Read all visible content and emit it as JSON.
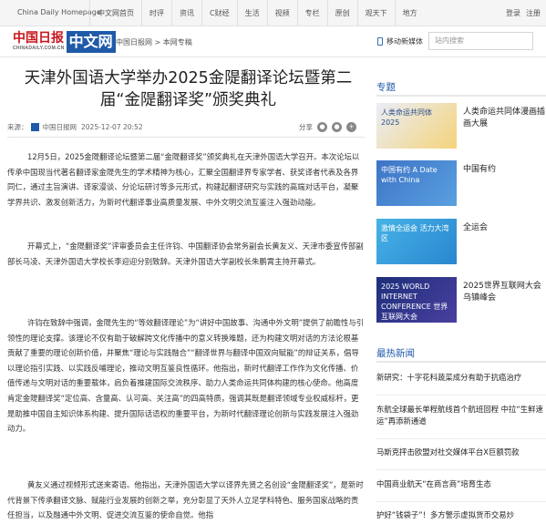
{
  "topbar": {
    "site": "China Daily Homepage",
    "nav": [
      "中文网首页",
      "时评",
      "资讯",
      "C财经",
      "生活",
      "视频",
      "专栏",
      "原创",
      "观天下",
      "地方"
    ],
    "login": "登录",
    "register": "注册"
  },
  "header": {
    "logo_cn": "中国日报",
    "logo_en": "CHINADAILY.COM.CN",
    "logo_box": "中文网",
    "breadcrumb": "中国日报网 > 本网专稿",
    "mobile": "移动新媒体",
    "search_placeholder": "站内搜索"
  },
  "article": {
    "title": "天津外国语大学举办2025金隄翻译论坛暨第二届“金隄翻译奖”颁奖典礼",
    "source_label": "来源：",
    "source": "中国日报网",
    "date": "2025-12-07 20:52",
    "share": "分享",
    "paragraphs": [
      "12月5日，2025金隄翻译论坛暨第二届“金隄翻译奖”颁奖典礼在天津外国语大学召开。本次论坛以传承中国现当代著名翻译家金隄先生的学术精神为核心，汇聚全国翻译界专家学者、获奖译者代表及各界同仁，通过主旨演讲、译家漫谈、分论坛研讨等多元形式，构建起翻译研究与实践的高端对话平台，凝聚学界共识、激发创新活力，为新时代翻译事业高质量发展、中外文明交流互鉴注入强劲动能。",
      "开幕式上，“金隄翻译奖”评审委员会主任许钧、中国翻译协会常务副会长黄友义、天津市委宣传部副部长马凌、天津外国语大学校长李迎迎分别致辞。天津外国语大学副校长朱鹏霄主持开幕式。",
      "许钧在致辞中强调，金隄先生的“等效翻译理论”为“讲好中国故事、沟通中外文明”提供了前瞻性与引领性的理论支撑。该理论不仅有助于破解跨文化传播中的意义转换难题，还为构建文明对话的方法论根基贡献了重要的理论创新价值，并聚焦“理论与实践融合”“翻译世界与翻译中国双向赋能”的辩证关系，倡导以理论指引实践、以实践反哺理论，推动文明互鉴良性循环。他指出，新时代翻译工作作为文化传播、价值传递与文明对话的重要载体，肩负着推建国际交流秩序、助力人类命运共同体构建的核心使命。他高度肯定金隄翻译奖“定位高、含量高、认可高、关注高”的四高特质，强调其既是翻译领域专业权威标杆，更是助推中国自主知识体系构建、提升国际话语权的重要平台，为新时代翻译理论创新与实践发展注入强劲动力。",
      "黄友义通过视频形式送来寄语。他指出，天津外国语大学以译界先贤之名创设“金隄翻译奖”，是新时代背景下传承翻译文脉、赋能行业发展的创新之举，充分彰显了天外人立足学科特色、服务国家战略的责任担当，以及融通中外文明、促进交流互鉴的使命自觉。他指"
    ]
  },
  "sidebar": {
    "topics_title": "专题",
    "topics": [
      {
        "thumb": "人类命运共同体 2025",
        "label": "人类命运共同体漫画插画大展"
      },
      {
        "thumb": "中国有约 A Date with China",
        "label": "中国有约"
      },
      {
        "thumb": "激情全运会 活力大湾区",
        "label": "全运会"
      },
      {
        "thumb": "2025 WORLD INTERNET CONFERENCE 世界互联网大会",
        "label": "2025世界互联网大会乌镇峰会"
      }
    ],
    "news_title": "最热新闻",
    "news": [
      "新研究：十字花科蔬菜成分有助于抗癌治疗",
      "东航全球最长单程航线首个航班回程 中拉“生鲜速运”再添新通道",
      "马斯克抨击欧盟对社交媒体平台X巨额罚款",
      "中国商业航天“在商言商”培育生态",
      "护好“钱袋子”！多方警示虚拟货币交易炒"
    ]
  },
  "colors": {
    "accent": "#1f5aa8",
    "brand_red": "#c8161d"
  }
}
